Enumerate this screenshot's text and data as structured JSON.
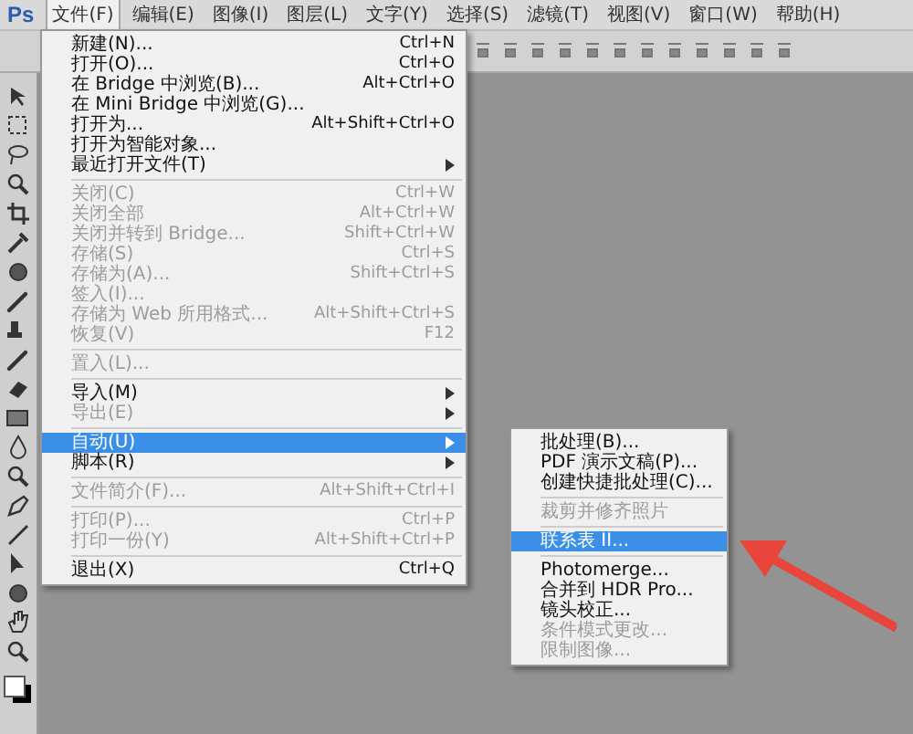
{
  "app_logo": "Ps",
  "menubar": [
    {
      "label": "文件(F)",
      "selected": true
    },
    {
      "label": "编辑(E)",
      "selected": false
    },
    {
      "label": "图像(I)",
      "selected": false
    },
    {
      "label": "图层(L)",
      "selected": false
    },
    {
      "label": "文字(Y)",
      "selected": false
    },
    {
      "label": "选择(S)",
      "selected": false
    },
    {
      "label": "滤镜(T)",
      "selected": false
    },
    {
      "label": "视图(V)",
      "selected": false
    },
    {
      "label": "窗口(W)",
      "selected": false
    },
    {
      "label": "帮助(H)",
      "selected": false
    }
  ],
  "file_menu": [
    {
      "kind": "item",
      "label": "新建(N)...",
      "shortcut": "Ctrl+N",
      "disabled": false,
      "selected": false,
      "submenu": false
    },
    {
      "kind": "item",
      "label": "打开(O)...",
      "shortcut": "Ctrl+O",
      "disabled": false,
      "selected": false,
      "submenu": false
    },
    {
      "kind": "item",
      "label": "在 Bridge 中浏览(B)...",
      "shortcut": "Alt+Ctrl+O",
      "disabled": false,
      "selected": false,
      "submenu": false
    },
    {
      "kind": "item",
      "label": "在 Mini Bridge 中浏览(G)...",
      "disabled": false,
      "selected": false,
      "submenu": false
    },
    {
      "kind": "item",
      "label": "打开为...",
      "shortcut": "Alt+Shift+Ctrl+O",
      "disabled": false,
      "selected": false,
      "submenu": false
    },
    {
      "kind": "item",
      "label": "打开为智能对象...",
      "disabled": false,
      "selected": false,
      "submenu": false
    },
    {
      "kind": "item",
      "label": "最近打开文件(T)",
      "disabled": false,
      "selected": false,
      "submenu": true
    },
    {
      "kind": "separator"
    },
    {
      "kind": "item",
      "label": "关闭(C)",
      "shortcut": "Ctrl+W",
      "disabled": true,
      "selected": false,
      "submenu": false
    },
    {
      "kind": "item",
      "label": "关闭全部",
      "shortcut": "Alt+Ctrl+W",
      "disabled": true,
      "selected": false,
      "submenu": false
    },
    {
      "kind": "item",
      "label": "关闭并转到 Bridge...",
      "shortcut": "Shift+Ctrl+W",
      "disabled": true,
      "selected": false,
      "submenu": false
    },
    {
      "kind": "item",
      "label": "存储(S)",
      "shortcut": "Ctrl+S",
      "disabled": true,
      "selected": false,
      "submenu": false
    },
    {
      "kind": "item",
      "label": "存储为(A)...",
      "shortcut": "Shift+Ctrl+S",
      "disabled": true,
      "selected": false,
      "submenu": false
    },
    {
      "kind": "item",
      "label": "签入(I)...",
      "disabled": true,
      "selected": false,
      "submenu": false
    },
    {
      "kind": "item",
      "label": "存储为 Web 所用格式...",
      "shortcut": "Alt+Shift+Ctrl+S",
      "disabled": true,
      "selected": false,
      "submenu": false
    },
    {
      "kind": "item",
      "label": "恢复(V)",
      "shortcut": "F12",
      "disabled": true,
      "selected": false,
      "submenu": false
    },
    {
      "kind": "separator"
    },
    {
      "kind": "item",
      "label": "置入(L)...",
      "disabled": true,
      "selected": false,
      "submenu": false
    },
    {
      "kind": "separator"
    },
    {
      "kind": "item",
      "label": "导入(M)",
      "disabled": false,
      "selected": false,
      "submenu": true
    },
    {
      "kind": "item",
      "label": "导出(E)",
      "disabled": true,
      "selected": false,
      "submenu": true
    },
    {
      "kind": "separator"
    },
    {
      "kind": "item",
      "label": "自动(U)",
      "disabled": false,
      "selected": true,
      "submenu": true
    },
    {
      "kind": "item",
      "label": "脚本(R)",
      "disabled": false,
      "selected": false,
      "submenu": true
    },
    {
      "kind": "separator"
    },
    {
      "kind": "item",
      "label": "文件简介(F)...",
      "shortcut": "Alt+Shift+Ctrl+I",
      "disabled": true,
      "selected": false,
      "submenu": false
    },
    {
      "kind": "separator"
    },
    {
      "kind": "item",
      "label": "打印(P)...",
      "shortcut": "Ctrl+P",
      "disabled": true,
      "selected": false,
      "submenu": false
    },
    {
      "kind": "item",
      "label": "打印一份(Y)",
      "shortcut": "Alt+Shift+Ctrl+P",
      "disabled": true,
      "selected": false,
      "submenu": false
    },
    {
      "kind": "separator"
    },
    {
      "kind": "item",
      "label": "退出(X)",
      "shortcut": "Ctrl+Q",
      "disabled": false,
      "selected": false,
      "submenu": false
    }
  ],
  "automate_submenu": [
    {
      "kind": "item",
      "label": "批处理(B)...",
      "disabled": false,
      "selected": false
    },
    {
      "kind": "item",
      "label": "PDF 演示文稿(P)...",
      "disabled": false,
      "selected": false
    },
    {
      "kind": "item",
      "label": "创建快捷批处理(C)...",
      "disabled": false,
      "selected": false
    },
    {
      "kind": "separator"
    },
    {
      "kind": "item",
      "label": "裁剪并修齐照片",
      "disabled": true,
      "selected": false
    },
    {
      "kind": "separator"
    },
    {
      "kind": "item",
      "label": "联系表 II...",
      "disabled": false,
      "selected": true
    },
    {
      "kind": "separator"
    },
    {
      "kind": "item",
      "label": "Photomerge...",
      "disabled": false,
      "selected": false
    },
    {
      "kind": "item",
      "label": "合并到 HDR Pro...",
      "disabled": false,
      "selected": false
    },
    {
      "kind": "item",
      "label": "镜头校正...",
      "disabled": false,
      "selected": false
    },
    {
      "kind": "item",
      "label": "条件模式更改...",
      "disabled": true,
      "selected": false
    },
    {
      "kind": "item",
      "label": "限制图像...",
      "disabled": true,
      "selected": false
    }
  ]
}
